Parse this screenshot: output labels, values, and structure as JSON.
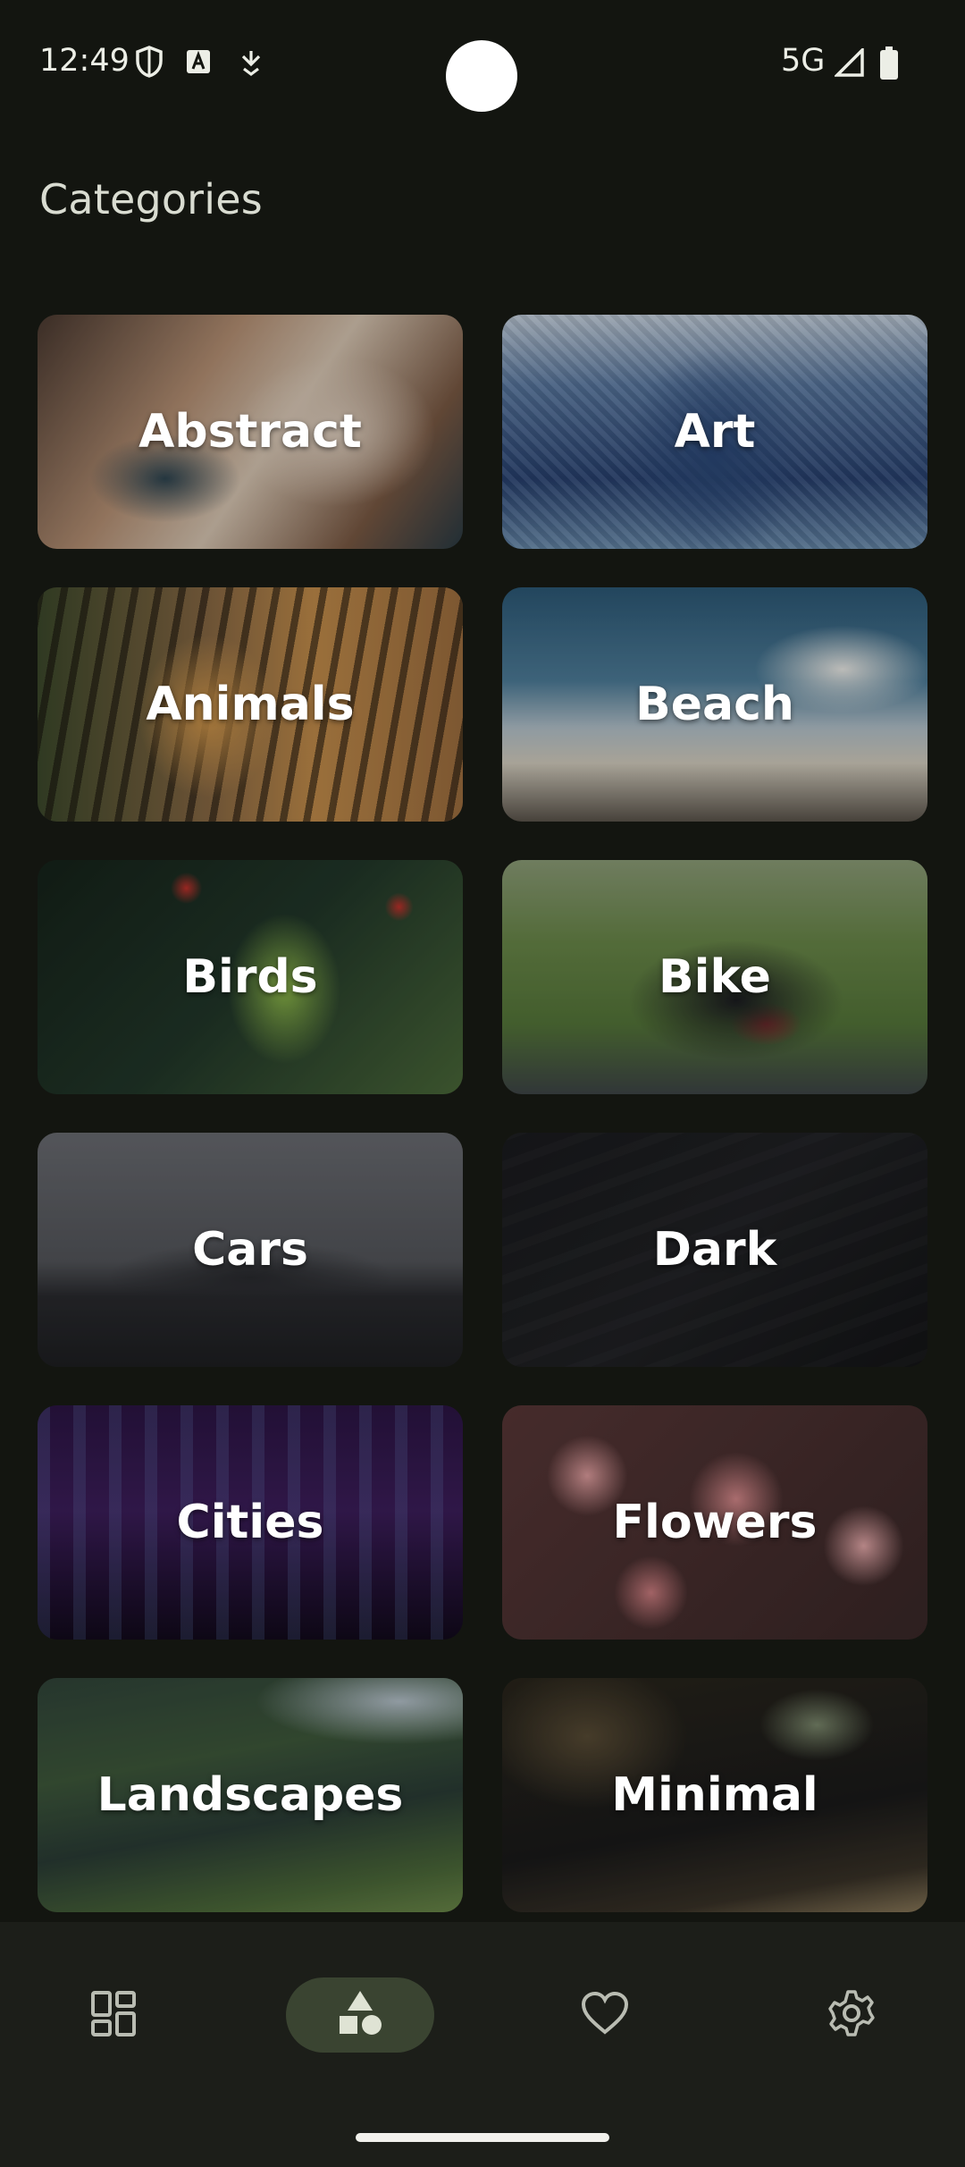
{
  "status_bar": {
    "time": "12:49",
    "network": "5G",
    "icons": [
      "shield-icon",
      "font-a-icon",
      "download-badge-icon",
      "signal-icon",
      "battery-icon"
    ]
  },
  "page": {
    "title": "Categories"
  },
  "categories": [
    {
      "label": "Abstract",
      "colors": [
        "#8a6f5c",
        "#d9c6b4",
        "#3b4b4f"
      ]
    },
    {
      "label": "Art",
      "colors": [
        "#3f5f8f",
        "#9db6cf",
        "#1c2f55"
      ]
    },
    {
      "label": "Animals",
      "colors": [
        "#6b5a3f",
        "#caa066",
        "#3a4a2a"
      ]
    },
    {
      "label": "Beach",
      "colors": [
        "#2f5d79",
        "#e6e1d2",
        "#4f4a43"
      ]
    },
    {
      "label": "Birds",
      "colors": [
        "#1c2e21",
        "#7fa34a",
        "#b53a32"
      ]
    },
    {
      "label": "Bike",
      "colors": [
        "#6c8a4f",
        "#2a2b2f",
        "#c43b3b"
      ]
    },
    {
      "label": "Cars",
      "colors": [
        "#5b5d63",
        "#2b2c30",
        "#a8a9ad"
      ]
    },
    {
      "label": "Dark",
      "colors": [
        "#1b1c1f",
        "#222326",
        "#141516"
      ]
    },
    {
      "label": "Cities",
      "colors": [
        "#3a1e56",
        "#211034",
        "#6d3fa0"
      ]
    },
    {
      "label": "Flowers",
      "colors": [
        "#d98a8e",
        "#3b2a2a",
        "#e7a9aa"
      ]
    },
    {
      "label": "Landscapes",
      "colors": [
        "#3f5a3c",
        "#9fb2c2",
        "#26332b"
      ]
    },
    {
      "label": "Minimal",
      "colors": [
        "#3a3326",
        "#17181a",
        "#6a5f48"
      ]
    }
  ],
  "nav": [
    {
      "name": "nav-wallpapers",
      "icon": "grid-icon",
      "active": false
    },
    {
      "name": "nav-categories",
      "icon": "shapes-icon",
      "active": true
    },
    {
      "name": "nav-favorites",
      "icon": "heart-icon",
      "active": false
    },
    {
      "name": "nav-settings",
      "icon": "gear-icon",
      "active": false
    }
  ]
}
